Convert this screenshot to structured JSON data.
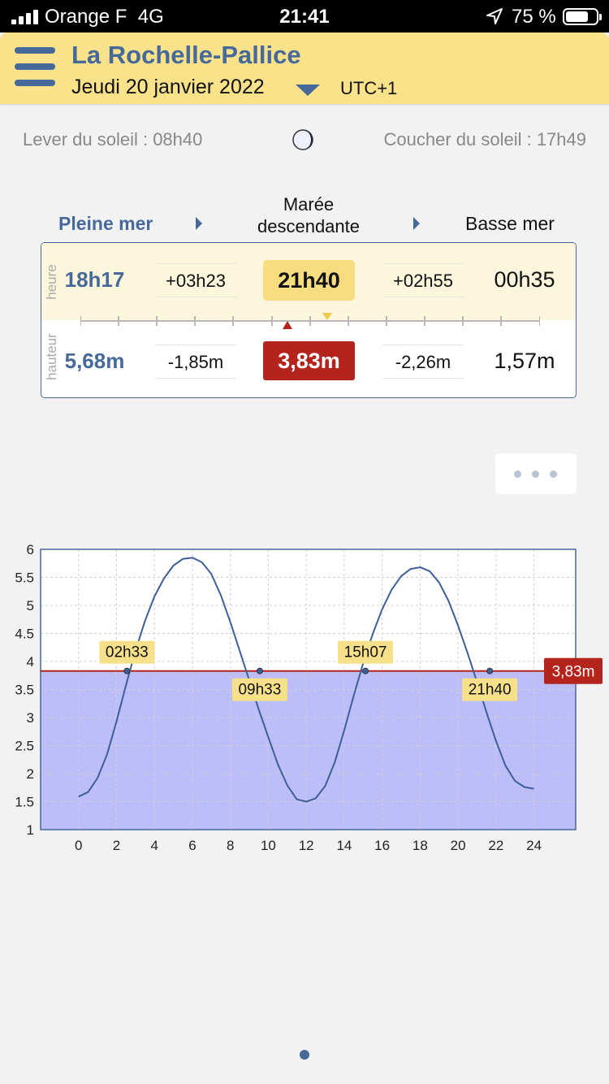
{
  "status": {
    "carrier": "Orange F",
    "network": "4G",
    "time": "21:41",
    "battery": "75 %",
    "battery_level": 0.75
  },
  "header": {
    "title": "La Rochelle-Pallice",
    "date": "Jeudi 20 janvier 2022",
    "timezone": "UTC+1"
  },
  "sun": {
    "sunrise": "Lever du soleil : 08h40",
    "sunset": "Coucher du soleil : 17h49"
  },
  "tide": {
    "high_label": "Pleine mer",
    "state_label_line1": "Marée",
    "state_label_line2": "descendante",
    "low_label": "Basse mer",
    "side_time": "heure",
    "side_height": "hauteur",
    "high_time": "18h17",
    "delta_time_1": "+03h23",
    "current_time": "21h40",
    "delta_time_2": "+02h55",
    "low_time": "00h35",
    "high_height": "5,68m",
    "delta_height_1": "-1,85m",
    "current_height": "3,83m",
    "delta_height_2": "-2,26m",
    "low_height": "1,57m"
  },
  "colors": {
    "accent": "#46699a",
    "header_bg": "#f9e289",
    "highlight": "#f7dc80",
    "danger": "#b5241c",
    "fill": "#bdbdfa"
  },
  "chart_data": {
    "type": "line",
    "x_ticks": [
      "0",
      "2",
      "4",
      "6",
      "8",
      "10",
      "12",
      "14",
      "16",
      "18",
      "20",
      "22",
      "24"
    ],
    "y_ticks": [
      "1",
      "1.5",
      "2",
      "2.5",
      "3",
      "3.5",
      "4",
      "4.5",
      "5",
      "5.5",
      "6"
    ],
    "xlim": [
      -2,
      26.2
    ],
    "ylim": [
      1,
      6
    ],
    "grid": true,
    "series": [
      {
        "x": [
          0,
          0.5,
          1,
          1.5,
          2,
          2.5,
          3,
          3.5,
          4,
          4.5,
          5,
          5.5,
          6,
          6.5,
          7,
          7.5,
          8,
          8.5,
          9,
          9.5,
          10,
          10.5,
          11,
          11.5,
          12,
          12.5,
          13,
          13.5,
          14,
          14.5,
          15,
          15.5,
          16,
          16.5,
          17,
          17.5,
          18,
          18.5,
          19,
          19.5,
          20,
          20.5,
          21,
          21.5,
          22,
          22.5,
          23,
          23.5,
          24
        ],
        "y": [
          1.59,
          1.67,
          1.92,
          2.34,
          2.93,
          3.58,
          4.19,
          4.72,
          5.16,
          5.48,
          5.71,
          5.83,
          5.85,
          5.77,
          5.56,
          5.18,
          4.7,
          4.18,
          3.66,
          3.14,
          2.65,
          2.17,
          1.79,
          1.54,
          1.5,
          1.56,
          1.78,
          2.2,
          2.77,
          3.39,
          3.97,
          4.49,
          4.93,
          5.28,
          5.52,
          5.65,
          5.68,
          5.61,
          5.41,
          5.08,
          4.64,
          4.15,
          3.63,
          3.09,
          2.58,
          2.14,
          1.87,
          1.76,
          1.73
        ]
      }
    ],
    "threshold": 3.83,
    "threshold_label": "3,83m",
    "markers": [
      {
        "x": 2.55,
        "y": 3.83,
        "label": "02h33",
        "pos": "above"
      },
      {
        "x": 9.55,
        "y": 3.83,
        "label": "09h33",
        "pos": "below"
      },
      {
        "x": 15.12,
        "y": 3.83,
        "label": "15h07",
        "pos": "above"
      },
      {
        "x": 21.67,
        "y": 3.83,
        "label": "21h40",
        "pos": "below"
      }
    ]
  }
}
